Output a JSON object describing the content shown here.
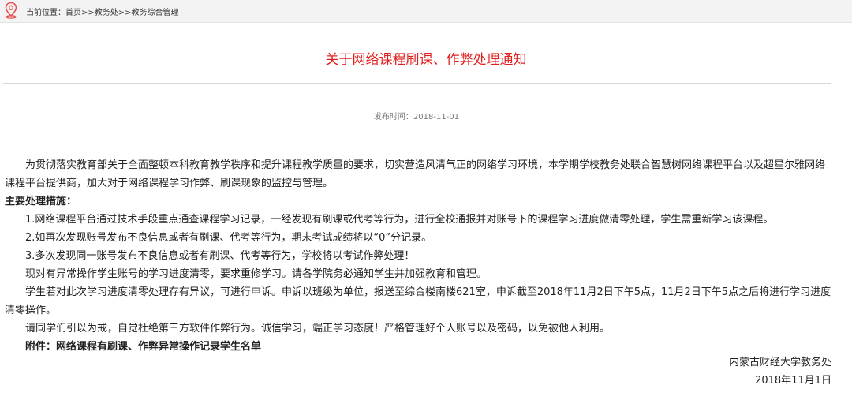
{
  "breadcrumb": {
    "prefix": "当前位置：",
    "items": [
      "首页",
      "教务处",
      "教务综合管理"
    ],
    "separator": ">>"
  },
  "notice": {
    "title": "关于网络课程刷课、作弊处理通知",
    "publish_label": "发布时间：",
    "publish_date": "2018-11-01",
    "intro": "为贯彻落实教育部关于全面整顿本科教育教学秩序和提升课程教学质量的要求，切实营造风清气正的网络学习环境，本学期学校教务处联合智慧树网络课程平台以及超星尔雅网络课程平台提供商，加大对于网络课程学习作弊、刷课现象的监控与管理。",
    "measures_heading": "主要处理措施：",
    "measures": [
      "1.网络课程平台通过技术手段重点通查课程学习记录，一经发现有刷课或代考等行为，进行全校通报并对账号下的课程学习进度做清零处理，学生需重新学习该课程。",
      "2.如再次发现账号发布不良信息或者有刷课、代考等行为，期末考试成绩将以“0”分记录。",
      "3.多次发现同一账号发布不良信息或者有刷课、代考等行为，学校将以考试作弊处理！"
    ],
    "paragraphs": [
      "现对有异常操作学生账号的学习进度清零，要求重修学习。请各学院务必通知学生并加强教育和管理。",
      "学生若对此次学习进度清零处理存有异议，可进行申诉。申诉以班级为单位，报送至综合楼南楼621室，申诉截至2018年11月2日下午5点，11月2日下午5点之后将进行学习进度清零操作。",
      "请同学们引以为戒，自觉杜绝第三方软件作弊行为。诚信学习，端正学习态度！严格管理好个人账号以及密码，以免被他人利用。"
    ],
    "attachment": "附件：网络课程有刷课、作弊异常操作记录学生名单",
    "signature_unit": "内蒙古财经大学教务处",
    "signature_date": "2018年11月1日"
  },
  "colors": {
    "title": "#e0201f",
    "location_icon": "#e55353",
    "topbar_bg": "#f3f3f3"
  },
  "icons": {
    "location": "map-pin-icon"
  }
}
